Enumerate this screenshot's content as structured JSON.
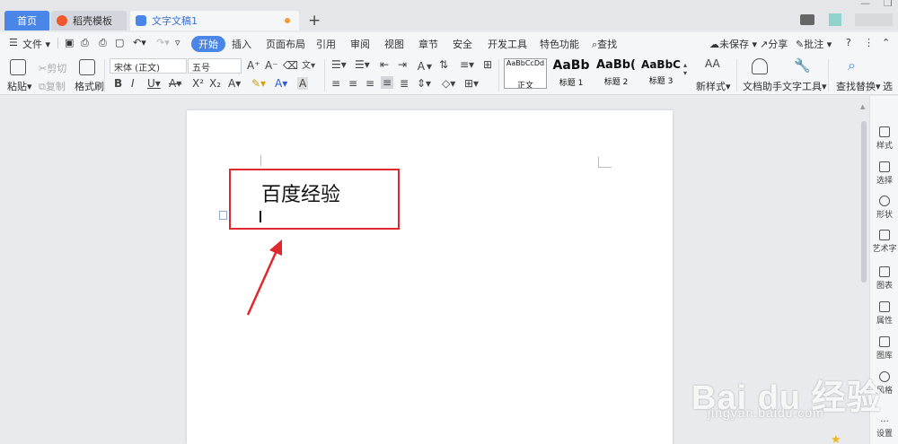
{
  "tabs": {
    "home": "首页",
    "templates": "稻壳模板",
    "document": "文字文稿1"
  },
  "window": {
    "new_tab": "+",
    "minimize": "—",
    "restore": "❐"
  },
  "menubar": {
    "file": "文件",
    "items": [
      "开始",
      "插入",
      "页面布局",
      "引用",
      "审阅",
      "视图",
      "章节",
      "安全",
      "开发工具",
      "特色功能"
    ],
    "search": "查找",
    "unsaved": "未保存",
    "share": "分享",
    "annotate": "批注",
    "help": "?",
    "more": "⋮"
  },
  "ribbon": {
    "paste": "粘贴",
    "cut": "剪切",
    "copy": "复制",
    "format_painter": "格式刷",
    "font_name": "宋体 (正文)",
    "font_size": "五号",
    "styles": [
      {
        "sample": "AaBbCcDd",
        "label": "正文"
      },
      {
        "sample": "AaBb",
        "label": "标题 1"
      },
      {
        "sample": "AaBb(",
        "label": "标题 2"
      },
      {
        "sample": "AaBbC",
        "label": "标题 3"
      }
    ],
    "new_style": "新样式",
    "doc_assistant": "文档助手",
    "text_tools": "文字工具",
    "find_replace": "查找替换",
    "select": "选"
  },
  "document": {
    "text": "百度经验"
  },
  "right_pane": [
    "样式",
    "选择",
    "形状",
    "艺术字",
    "图表",
    "属性",
    "图库",
    "风格",
    "设置"
  ],
  "watermark": {
    "brand": "Bai du 经验",
    "url": "jingyan.baidu.com"
  },
  "colors": {
    "accent": "#4a86e8",
    "highlight_box": "#e0282e"
  }
}
